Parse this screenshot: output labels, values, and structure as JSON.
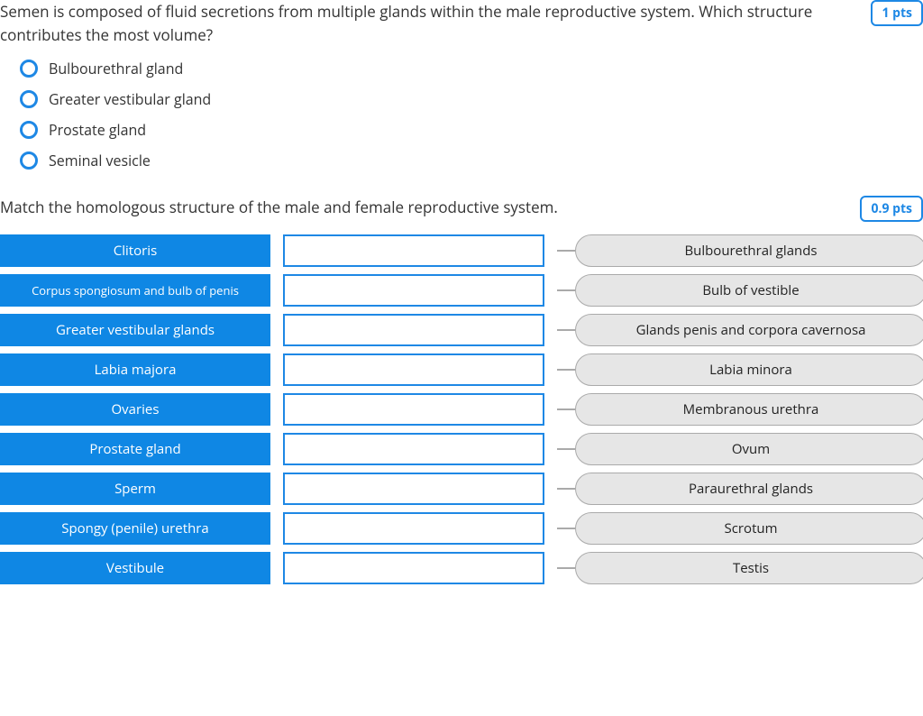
{
  "q1": {
    "text": "Semen is composed of fluid secretions from multiple glands within the male reproductive system. Which structure contributes the most volume?",
    "pts": "1 pts",
    "options": [
      "Bulbourethral gland",
      "Greater vestibular gland",
      "Prostate gland",
      "Seminal vesicle"
    ]
  },
  "q2": {
    "text": "Match the homologous structure of the male and female reproductive system.",
    "pts": "0.9 pts",
    "terms": [
      "Clitoris",
      "Corpus spongiosum and bulb of penis",
      "Greater vestibular glands",
      "Labia majora",
      "Ovaries",
      "Prostate gland",
      "Sperm",
      "Spongy (penile) urethra",
      "Vestibule"
    ],
    "answers": [
      "Bulbourethral glands",
      "Bulb of vestible",
      "Glands penis and corpora cavernosa",
      "Labia minora",
      "Membranous urethra",
      "Ovum",
      "Paraurethral glands",
      "Scrotum",
      "Testis"
    ]
  }
}
